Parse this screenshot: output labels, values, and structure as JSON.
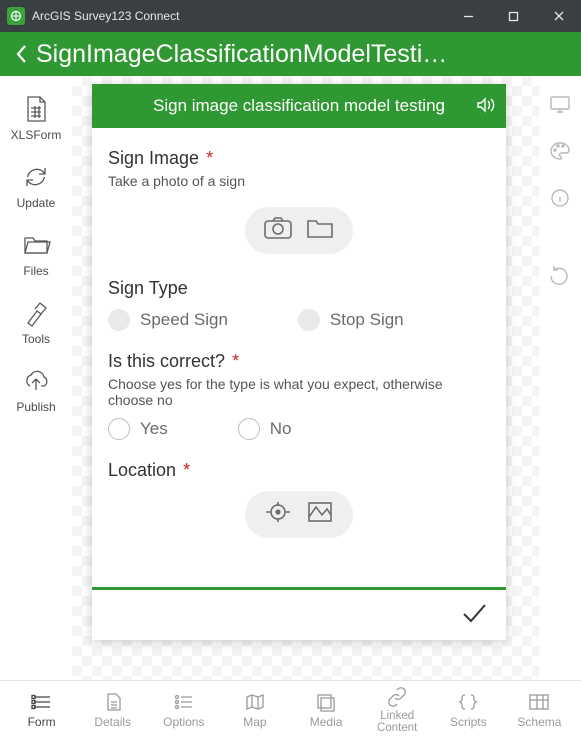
{
  "app": {
    "title": "ArcGIS Survey123 Connect"
  },
  "header": {
    "page_title": "SignImageClassificationModelTesti…"
  },
  "left_rail": [
    {
      "label": "XLSForm"
    },
    {
      "label": "Update"
    },
    {
      "label": "Files"
    },
    {
      "label": "Tools"
    },
    {
      "label": "Publish"
    }
  ],
  "form": {
    "title": "Sign image classification model testing",
    "q1": {
      "label": "Sign Image",
      "required": "*",
      "hint": "Take a photo of a sign"
    },
    "q2": {
      "label": "Sign Type",
      "opt1": "Speed Sign",
      "opt2": "Stop Sign"
    },
    "q3": {
      "label": "Is this correct?",
      "required": "*",
      "hint": "Choose yes for the type is what you expect, otherwise choose no",
      "opt1": "Yes",
      "opt2": "No"
    },
    "q4": {
      "label": "Location",
      "required": "*"
    }
  },
  "tabs": [
    {
      "label": "Form"
    },
    {
      "label": "Details"
    },
    {
      "label": "Options"
    },
    {
      "label": "Map"
    },
    {
      "label": "Media"
    },
    {
      "label": "Linked Content"
    },
    {
      "label": "Scripts"
    },
    {
      "label": "Schema"
    }
  ]
}
